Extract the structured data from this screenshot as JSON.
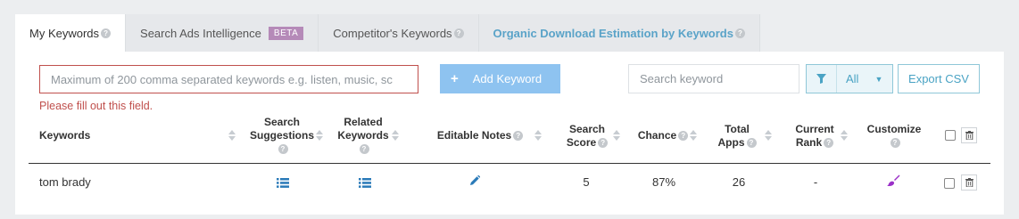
{
  "tabs": [
    {
      "label": "My Keywords",
      "active": true
    },
    {
      "label": "Search Ads Intelligence",
      "badge": "BETA"
    },
    {
      "label": "Competitor's Keywords"
    },
    {
      "label": "Organic Download Estimation by Keywords"
    }
  ],
  "controls": {
    "keywords_placeholder": "Maximum of 200 comma separated keywords e.g. listen, music, sc",
    "error_message": "Please fill out this field.",
    "add_button": "Add Keyword",
    "search_placeholder": "Search keyword",
    "filter_value": "All",
    "export_button": "Export CSV"
  },
  "table": {
    "headers": {
      "keywords": "Keywords",
      "suggestions_1": "Search",
      "suggestions_2": "Suggestions",
      "related_1": "Related",
      "related_2": "Keywords",
      "notes": "Editable Notes",
      "score_1": "Search",
      "score_2": "Score",
      "chance": "Chance",
      "apps_1": "Total",
      "apps_2": "Apps",
      "rank_1": "Current",
      "rank_2": "Rank",
      "customize": "Customize"
    },
    "rows": [
      {
        "keyword": "tom brady",
        "search_score": "5",
        "chance": "87%",
        "total_apps": "26",
        "current_rank": "-"
      }
    ]
  },
  "colors": {
    "accent": "#4aa3c4",
    "error": "#c0504d",
    "add_button": "#8ec3f0",
    "customize_icon": "#9b30c8",
    "beta_badge": "#b58ab8"
  },
  "icons": [
    "help-icon",
    "plus-icon",
    "filter-icon",
    "caret-down-icon",
    "list-icon",
    "pencil-icon",
    "brush-icon",
    "trash-icon"
  ]
}
